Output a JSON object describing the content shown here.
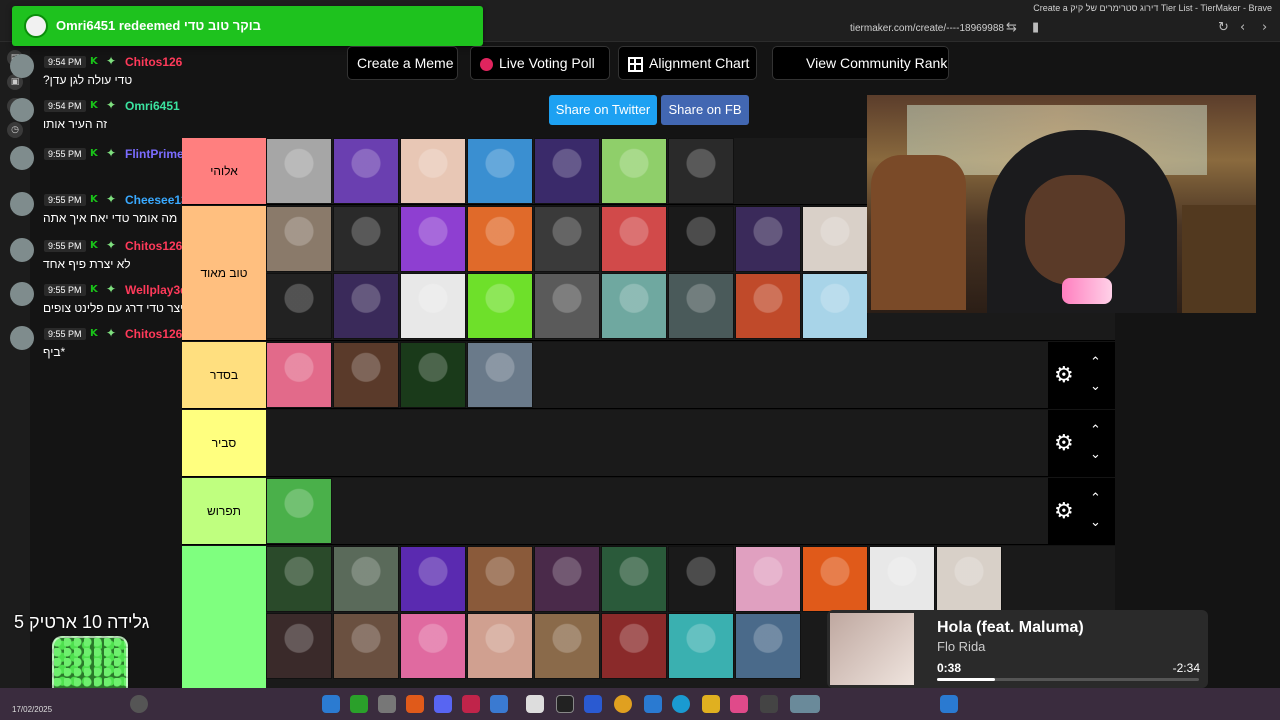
{
  "browser": {
    "window_title": "Create a דירוג סטרימרים של קיק Tier List - TierMaker - Brave",
    "url": "tiermaker.com/create/----18969988"
  },
  "redeem": {
    "text": "Omri6451 redeemed בוקר טוב טדי"
  },
  "chat": [
    {
      "time": "9:54 PM",
      "user": "Chitos126",
      "color": "#ff3a5a",
      "text": "טדי עולה לגן עדן?"
    },
    {
      "time": "9:54 PM",
      "user": "Omri6451",
      "color": "#3be3a0",
      "text": "זה העיר אותו"
    },
    {
      "time": "9:55 PM",
      "user": "FlintPrime",
      "color": "#7b6cff",
      "text": ""
    },
    {
      "time": "9:55 PM",
      "user": "Cheesee135",
      "color": "#39a9ff",
      "text": "מה אומר טדי יאח איך אתה"
    },
    {
      "time": "9:55 PM",
      "user": "Chitos126",
      "color": "#ff3a5a",
      "text": "לא יצרת פיף אחד"
    },
    {
      "time": "9:55 PM",
      "user": "Wellplay3d",
      "color": "#ff3a5a",
      "text": "קיצר טדי דרג עם פלינט צופים"
    },
    {
      "time": "9:55 PM",
      "user": "Chitos126",
      "color": "#ff3a5a",
      "text": "*ביף"
    }
  ],
  "toolbar": {
    "create_meme": "Create a Meme",
    "live_poll": "Live Voting Poll",
    "alignment": "Alignment Chart",
    "community": "View Community Rank",
    "share_twitter": "Share on Twitter",
    "share_fb": "Share on FB"
  },
  "tiers": [
    {
      "label": "אלוהי",
      "color": "#ff7f7f",
      "items": [
        "#a6a6a6",
        "#6a3fb0",
        "#e8c7b5",
        "#3a8fd1",
        "#3a2a6a",
        "#8fcf6a",
        "#2a2a2a"
      ]
    },
    {
      "label": "טוב מאוד",
      "color": "#ffbf7f",
      "items": [
        "#8a7a6a",
        "#2a2a2a",
        "#8e3fd1",
        "#e06a2a",
        "#3a3a3a",
        "#d14a4a",
        "#1a1a1a",
        "#3a2a5a",
        "#d9d0c8",
        "#222222",
        "#3a2a5a",
        "#e8e8e8",
        "#6ee02a",
        "#5a5a5a",
        "#6fa8a0",
        "#4a5a5a",
        "#c04a2a",
        "#a8d4e8"
      ]
    },
    {
      "label": "בסדר",
      "color": "#ffdf7f",
      "items": [
        "#e26a8a",
        "#5a3a2a",
        "#1a3a1a",
        "#6a7a8a"
      ]
    },
    {
      "label": "סביר",
      "color": "#ffff7f",
      "items": []
    },
    {
      "label": "תפרוש",
      "color": "#bfff7f",
      "items": [
        "#4ab04a"
      ]
    },
    {
      "label": "",
      "color": "#7fff7f",
      "items": [
        "#2a4a2a",
        "#5a6a5a",
        "#5a2ab0",
        "#8a5a3a",
        "#4a2a4a",
        "#2a5a3a",
        "#1a1a1a",
        "#e0a0c0",
        "#e05a1a",
        "#e8e8e8",
        "#d8d0c8",
        "#3a2a2a",
        "#6a5040",
        "#e06aa0",
        "#d0a090",
        "#8a6a4a",
        "#8a2a2a",
        "#3ab0b0",
        "#4a6a8a"
      ]
    }
  ],
  "overlay": {
    "goal_text": "גלידה 10 ארטיק 5"
  },
  "media": {
    "title": "Hola (feat. Maluma)",
    "artist": "Flo Rida",
    "elapsed": "0:38",
    "remaining": "-2:34",
    "progress": 0.22
  },
  "taskbar": {
    "date": "17/02/2025"
  }
}
